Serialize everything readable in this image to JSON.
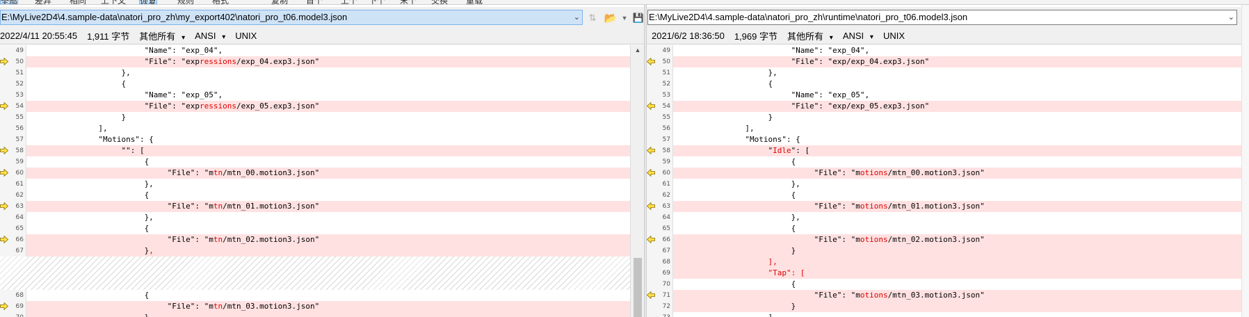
{
  "toolbar": {
    "items": [
      "全部",
      "差异",
      "相同",
      "上下文",
      "恢复",
      "规则",
      "格式",
      "复制",
      "首个",
      "上个",
      "下个",
      "末个",
      "交换",
      "重载"
    ]
  },
  "left": {
    "path": "E:\\MyLive2D4\\4.sample-data\\natori_pro_zh\\my_export402\\natori_pro_t06.model3.json",
    "datetime": "2022/4/11 20:55:45",
    "size": "1,911 字节",
    "filter": "其他所有",
    "encoding": "ANSI",
    "eol": "UNIX"
  },
  "right": {
    "path": "E:\\MyLive2D4\\4.sample-data\\natori_pro_zh\\runtime\\natori_pro_t06.model3.json",
    "datetime": "2021/6/2 18:36:50",
    "size": "1,969 字节",
    "filter": "其他所有",
    "encoding": "ANSI",
    "eol": "UNIX"
  },
  "icons": {
    "path_dropdown": "chevron-down-icon",
    "sync": "sync-arrows-icon",
    "open": "folder-open-icon",
    "open_menu": "triangle-down-icon",
    "save": "save-disk-icon",
    "diff_arrow": "yellow-arrow-icon",
    "scroll_up": "scroll-up-arrow-icon"
  },
  "colors": {
    "diff_line": "#ffe1e1",
    "diff_text": "#e00000",
    "arrow_fill": "#ffe14d",
    "selected_path": "#cfe3f7"
  },
  "left_lines": [
    {
      "n": "49",
      "diff": false,
      "arrow": false,
      "parts": [
        [
          "                         \"Name\": \"exp_04\",",
          false
        ]
      ]
    },
    {
      "n": "50",
      "diff": true,
      "arrow": true,
      "parts": [
        [
          "                         \"File\": \"exp",
          false
        ],
        [
          "ressions",
          true
        ],
        [
          "/exp_04.exp3.json\"",
          false
        ]
      ]
    },
    {
      "n": "51",
      "diff": false,
      "arrow": false,
      "parts": [
        [
          "                    },",
          false
        ]
      ]
    },
    {
      "n": "52",
      "diff": false,
      "arrow": false,
      "parts": [
        [
          "                    {",
          false
        ]
      ]
    },
    {
      "n": "53",
      "diff": false,
      "arrow": false,
      "parts": [
        [
          "                         \"Name\": \"exp_05\",",
          false
        ]
      ]
    },
    {
      "n": "54",
      "diff": true,
      "arrow": true,
      "parts": [
        [
          "                         \"File\": \"exp",
          false
        ],
        [
          "ressions",
          true
        ],
        [
          "/exp_05.exp3.json\"",
          false
        ]
      ]
    },
    {
      "n": "55",
      "diff": false,
      "arrow": false,
      "parts": [
        [
          "                    }",
          false
        ]
      ]
    },
    {
      "n": "56",
      "diff": false,
      "arrow": false,
      "parts": [
        [
          "               ],",
          false
        ]
      ]
    },
    {
      "n": "57",
      "diff": false,
      "arrow": false,
      "parts": [
        [
          "               \"Motions\": {",
          false
        ]
      ]
    },
    {
      "n": "58",
      "diff": true,
      "arrow": true,
      "parts": [
        [
          "                    \"\": [",
          false
        ]
      ]
    },
    {
      "n": "59",
      "diff": false,
      "arrow": false,
      "parts": [
        [
          "                         {",
          false
        ]
      ]
    },
    {
      "n": "60",
      "diff": true,
      "arrow": true,
      "parts": [
        [
          "                              \"File\": \"m",
          false
        ],
        [
          "tn",
          true
        ],
        [
          "/mtn_00.motion3.json\"",
          false
        ]
      ]
    },
    {
      "n": "61",
      "diff": false,
      "arrow": false,
      "parts": [
        [
          "                         },",
          false
        ]
      ]
    },
    {
      "n": "62",
      "diff": false,
      "arrow": false,
      "parts": [
        [
          "                         {",
          false
        ]
      ]
    },
    {
      "n": "63",
      "diff": true,
      "arrow": true,
      "parts": [
        [
          "                              \"File\": \"m",
          false
        ],
        [
          "tn",
          true
        ],
        [
          "/mtn_01.motion3.json\"",
          false
        ]
      ]
    },
    {
      "n": "64",
      "diff": false,
      "arrow": false,
      "parts": [
        [
          "                         },",
          false
        ]
      ]
    },
    {
      "n": "65",
      "diff": false,
      "arrow": false,
      "parts": [
        [
          "                         {",
          false
        ]
      ]
    },
    {
      "n": "66",
      "diff": true,
      "arrow": true,
      "parts": [
        [
          "                              \"File\": \"m",
          false
        ],
        [
          "tn",
          true
        ],
        [
          "/mtn_02.motion3.json\"",
          false
        ]
      ]
    },
    {
      "n": "67",
      "diff": true,
      "arrow": false,
      "parts": [
        [
          "                         }",
          false
        ],
        [
          ",",
          true
        ]
      ]
    },
    {
      "hatch": true
    },
    {
      "n": "68",
      "diff": false,
      "arrow": false,
      "parts": [
        [
          "                         {",
          false
        ]
      ]
    },
    {
      "n": "69",
      "diff": true,
      "arrow": true,
      "parts": [
        [
          "                              \"File\": \"m",
          false
        ],
        [
          "tn",
          true
        ],
        [
          "/mtn_03.motion3.json\"",
          false
        ]
      ]
    },
    {
      "n": "70",
      "diff": true,
      "arrow": false,
      "parts": [
        [
          "                         }",
          false
        ],
        [
          ",",
          true
        ]
      ]
    }
  ],
  "right_lines": [
    {
      "n": "49",
      "diff": false,
      "arrow": false,
      "parts": [
        [
          "                         \"Name\": \"exp_04\",",
          false
        ]
      ]
    },
    {
      "n": "50",
      "diff": true,
      "arrow": true,
      "parts": [
        [
          "                         \"File\": \"exp/exp_04.exp3.json\"",
          false
        ]
      ]
    },
    {
      "n": "51",
      "diff": false,
      "arrow": false,
      "parts": [
        [
          "                    },",
          false
        ]
      ]
    },
    {
      "n": "52",
      "diff": false,
      "arrow": false,
      "parts": [
        [
          "                    {",
          false
        ]
      ]
    },
    {
      "n": "53",
      "diff": false,
      "arrow": false,
      "parts": [
        [
          "                         \"Name\": \"exp_05\",",
          false
        ]
      ]
    },
    {
      "n": "54",
      "diff": true,
      "arrow": true,
      "parts": [
        [
          "                         \"File\": \"exp/exp_05.exp3.json\"",
          false
        ]
      ]
    },
    {
      "n": "55",
      "diff": false,
      "arrow": false,
      "parts": [
        [
          "                    }",
          false
        ]
      ]
    },
    {
      "n": "56",
      "diff": false,
      "arrow": false,
      "parts": [
        [
          "               ],",
          false
        ]
      ]
    },
    {
      "n": "57",
      "diff": false,
      "arrow": false,
      "parts": [
        [
          "               \"Motions\": {",
          false
        ]
      ]
    },
    {
      "n": "58",
      "diff": true,
      "arrow": true,
      "parts": [
        [
          "                    \"",
          false
        ],
        [
          "Idle",
          true
        ],
        [
          "\": [",
          false
        ]
      ]
    },
    {
      "n": "59",
      "diff": false,
      "arrow": false,
      "parts": [
        [
          "                         {",
          false
        ]
      ]
    },
    {
      "n": "60",
      "diff": true,
      "arrow": true,
      "parts": [
        [
          "                              \"File\": \"m",
          false
        ],
        [
          "otions",
          true
        ],
        [
          "/mtn_00.motion3.json\"",
          false
        ]
      ]
    },
    {
      "n": "61",
      "diff": false,
      "arrow": false,
      "parts": [
        [
          "                         },",
          false
        ]
      ]
    },
    {
      "n": "62",
      "diff": false,
      "arrow": false,
      "parts": [
        [
          "                         {",
          false
        ]
      ]
    },
    {
      "n": "63",
      "diff": true,
      "arrow": true,
      "parts": [
        [
          "                              \"File\": \"m",
          false
        ],
        [
          "otions",
          true
        ],
        [
          "/mtn_01.motion3.json\"",
          false
        ]
      ]
    },
    {
      "n": "64",
      "diff": false,
      "arrow": false,
      "parts": [
        [
          "                         },",
          false
        ]
      ]
    },
    {
      "n": "65",
      "diff": false,
      "arrow": false,
      "parts": [
        [
          "                         {",
          false
        ]
      ]
    },
    {
      "n": "66",
      "diff": true,
      "arrow": true,
      "parts": [
        [
          "                              \"File\": \"m",
          false
        ],
        [
          "otions",
          true
        ],
        [
          "/mtn_02.motion3.json\"",
          false
        ]
      ]
    },
    {
      "n": "67",
      "diff": true,
      "arrow": false,
      "parts": [
        [
          "                         }",
          false
        ]
      ]
    },
    {
      "n": "68",
      "diff": true,
      "arrow": false,
      "parts": [
        [
          "                    ",
          false
        ],
        [
          "],",
          true
        ]
      ]
    },
    {
      "n": "69",
      "diff": true,
      "arrow": false,
      "parts": [
        [
          "                    ",
          false
        ],
        [
          "\"Tap\": [",
          true
        ]
      ]
    },
    {
      "n": "70",
      "diff": false,
      "arrow": false,
      "parts": [
        [
          "                         {",
          false
        ]
      ]
    },
    {
      "n": "71",
      "diff": true,
      "arrow": true,
      "parts": [
        [
          "                              \"File\": \"m",
          false
        ],
        [
          "otions",
          true
        ],
        [
          "/mtn_03.motion3.json\"",
          false
        ]
      ]
    },
    {
      "n": "72",
      "diff": true,
      "arrow": false,
      "parts": [
        [
          "                         }",
          false
        ]
      ]
    },
    {
      "n": "73",
      "diff": false,
      "arrow": false,
      "parts": [
        [
          "                    ]",
          false
        ]
      ]
    }
  ]
}
